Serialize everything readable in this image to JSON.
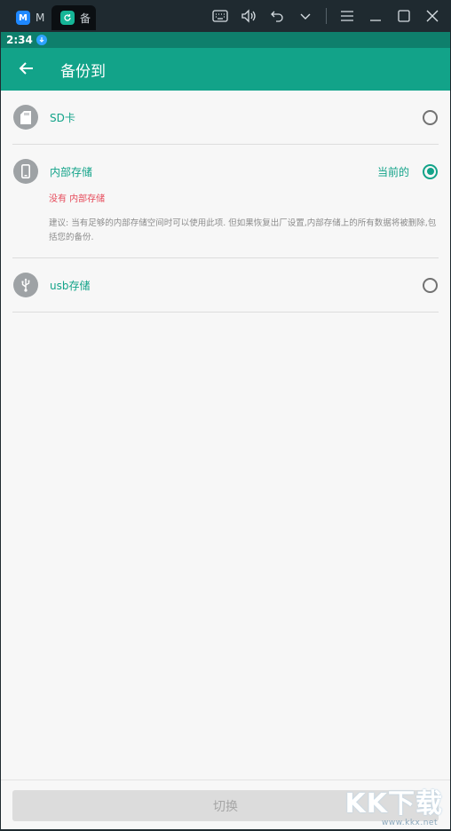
{
  "emulator": {
    "tab1": {
      "icon": "M",
      "label": "M"
    },
    "tab2": {
      "icon": "refresh-icon",
      "label": "备"
    },
    "toolbar_icons": [
      "keyboard-icon",
      "volume-icon",
      "undo-icon",
      "chevron-down-icon",
      "menu-icon",
      "minimize-icon",
      "maximize-icon",
      "close-icon"
    ]
  },
  "status_bar": {
    "time": "2:34"
  },
  "app_bar": {
    "title": "备份到",
    "back_icon": "arrow-left-icon"
  },
  "storage_options": [
    {
      "icon": "sd-card-icon",
      "label": "SD卡",
      "selected": false
    },
    {
      "icon": "phone-icon",
      "label": "内部存储",
      "selected": true,
      "current_label": "当前的",
      "error": "没有 内部存储",
      "note": "建议: 当有足够的内部存储空间时可以使用此项. 但如果恢复出厂设置,内部存储上的所有数据将被删除,包括您的备份."
    },
    {
      "icon": "usb-icon",
      "label": "usb存储",
      "selected": false
    }
  ],
  "footer": {
    "button_label": "切换"
  },
  "watermark": {
    "logo_text": "KK下载",
    "url": "www.kkx.net"
  },
  "colors": {
    "accent": "#12a389",
    "status_bar": "#0e7f6c",
    "error": "#e64a5a",
    "disabled_button": "#dcdcdc"
  }
}
